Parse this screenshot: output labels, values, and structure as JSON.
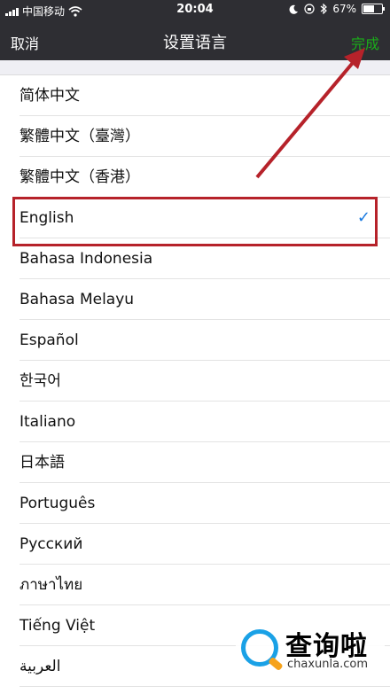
{
  "status_bar": {
    "carrier": "中国移动",
    "time": "20:04",
    "battery_text": "67%",
    "battery_level": 0.67
  },
  "navbar": {
    "cancel_label": "取消",
    "title": "设置语言",
    "done_label": "完成",
    "done_color": "#1aad19"
  },
  "languages": [
    {
      "label": "简体中文"
    },
    {
      "label": "繁體中文（臺灣）"
    },
    {
      "label": "繁體中文（香港）"
    },
    {
      "label": "English",
      "selected": true
    },
    {
      "label": "Bahasa Indonesia"
    },
    {
      "label": "Bahasa Melayu"
    },
    {
      "label": "Español"
    },
    {
      "label": "한국어"
    },
    {
      "label": "Italiano"
    },
    {
      "label": "日本語"
    },
    {
      "label": "Português"
    },
    {
      "label": "Русский"
    },
    {
      "label": "ภาษาไทย"
    },
    {
      "label": "Tiếng Việt"
    },
    {
      "label": "العربية"
    }
  ],
  "check_icon": "checkmark-icon",
  "annotation": {
    "highlight_color": "#b6222a"
  },
  "watermark": {
    "main": "查询啦",
    "sub": "chaxunla.com"
  }
}
